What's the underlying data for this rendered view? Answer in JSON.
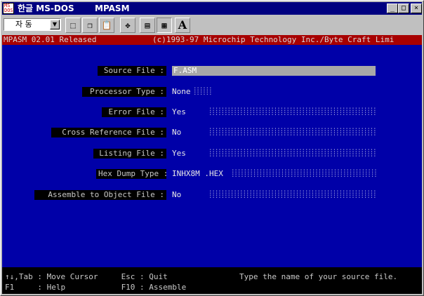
{
  "window": {
    "title": "한글 MS-DOS",
    "app": "MPASM",
    "icon_text": "MS\nDOS"
  },
  "toolbar": {
    "font_value": "자 동",
    "font_bold_letter": "A"
  },
  "header": {
    "version": "MPASM 02.01 Released",
    "copyright": "(c)1993-97 Microchip Technology Inc./Byte Craft Limi"
  },
  "form": {
    "source_file_label": "Source File :",
    "source_file_value": "F.ASM",
    "processor_type_label": "Processor Type :",
    "processor_type_value": "None",
    "error_file_label": "Error File :",
    "error_file_value": "Yes",
    "cross_reference_label": "Cross Reference File :",
    "cross_reference_value": "No",
    "listing_file_label": "Listing File :",
    "listing_file_value": "Yes",
    "hex_dump_label": "Hex Dump Type :",
    "hex_dump_value": "INHX8M .HEX",
    "assemble_object_label": "Assemble to Object File :",
    "assemble_object_value": "No"
  },
  "footer": {
    "help_line1": "↑↓,Tab : Move Cursor     Esc : Quit",
    "help_line2": "F1     : Help            F10 : Assemble",
    "message": "Type the name of your source file."
  },
  "colors": {
    "dos_background": "#0000a8",
    "header_background": "#a80000",
    "title_bar": "#000080"
  }
}
